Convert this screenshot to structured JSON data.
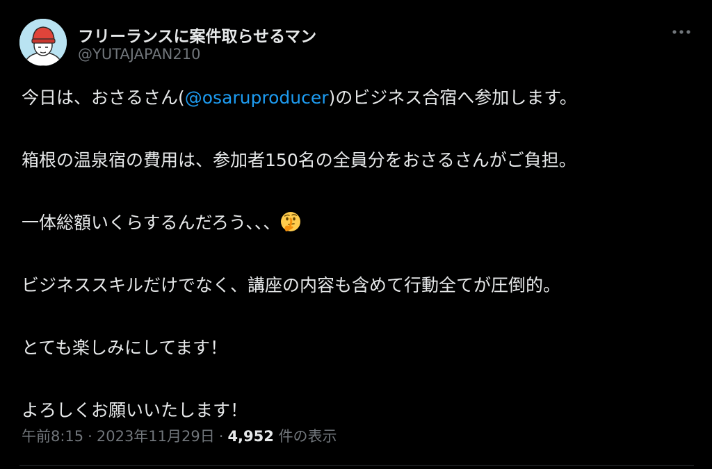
{
  "tweet": {
    "author": {
      "display_name": "フリーランスに案件取らせるマン",
      "handle": "@YUTAJAPAN210",
      "avatar_icon": "person-red-beanie-avatar"
    },
    "more_icon": "more-horizontal-icon",
    "lines": {
      "p1_before": "今日は、おさるさん(",
      "p1_mention": "@osaruproducer",
      "p1_after": ")のビジネス合宿へ参加します。",
      "p2": "箱根の温泉宿の費用は、参加者150名の全員分をおさるさんがご負担。",
      "p3": "一体総額いくらするんだろう､､､",
      "p3_emoji": "thinking-face-emoji",
      "p4": "ビジネススキルだけでなく、講座の内容も含めて行動全てが圧倒的。",
      "p5": "とても楽しみにしてます！",
      "p6": "よろしくお願いいたします！"
    },
    "meta": {
      "time": "午前8:15",
      "separator": "·",
      "date": "2023年11月29日",
      "views_count": "4,952",
      "views_label": "件の表示"
    },
    "colors": {
      "background": "#000000",
      "text": "#e7e9ea",
      "secondary": "#71767b",
      "link": "#1d9bf0"
    }
  }
}
